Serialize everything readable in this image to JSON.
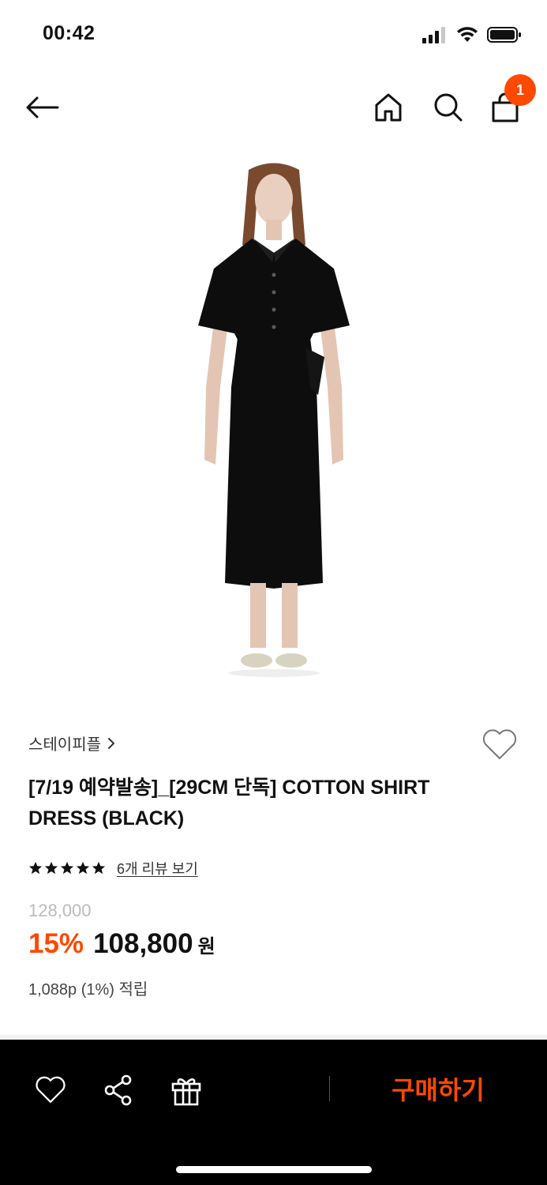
{
  "status_bar": {
    "time": "00:42"
  },
  "nav": {
    "back_icon": "arrow-left-icon",
    "home_icon": "home-icon",
    "search_icon": "search-icon",
    "bag_icon": "shopping-bag-icon",
    "cart_count": "1"
  },
  "product": {
    "image_alt": "black short-sleeve shirt dress on model",
    "brand": "스테이피플",
    "brand_chevron": "›",
    "title": "[7/19 예약발송]_[29CM 단독] COTTON SHIRT DRESS (BLACK)",
    "rating_stars": 5,
    "review_link": "6개 리뷰 보기",
    "original_price": "128,000",
    "discount": "15%",
    "sale_price": "108,800",
    "currency": "원",
    "points": "1,088p (1%) 적립"
  },
  "bottom_bar": {
    "like_icon": "heart-icon",
    "share_icon": "share-icon",
    "gift_icon": "gift-icon",
    "buy_label": "구매하기"
  },
  "colors": {
    "accent": "#ff4800",
    "bottom_bar_bg": "#000000",
    "dress": "#0d0d0d"
  }
}
